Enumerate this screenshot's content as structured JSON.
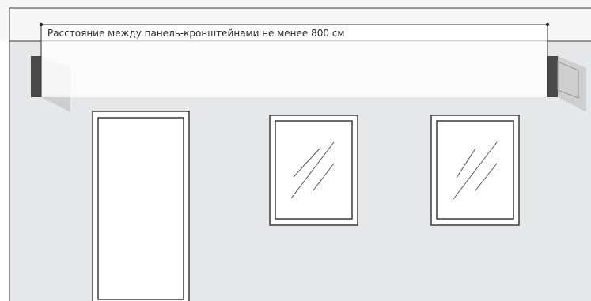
{
  "diagram": {
    "distance_label": "Расстояние между панель-кронштейнами не менее 800 см"
  },
  "colors": {
    "ceiling": "#f7f7f7",
    "wall": "#e6e7e9",
    "outline": "#3a3a3a",
    "bracket": "#4a4a4a",
    "panel": "#ffffff"
  }
}
